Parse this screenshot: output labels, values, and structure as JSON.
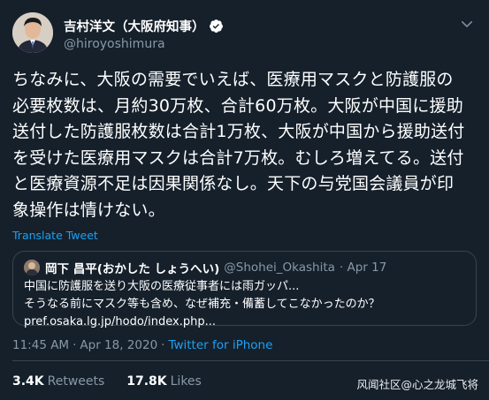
{
  "author": {
    "display_name": "吉村洋文（大阪府知事）",
    "handle": "@hiroyoshimura"
  },
  "tweet": {
    "lines": [
      "ちなみに、大阪の需要でいえば、医療用マスクと防護服の",
      "必要枚数は、月約30万枚、合計60万枚。大阪が中国に援助",
      "送付した防護服枚数は合計1万枚、大阪が中国から援助送付",
      "を受けた医療用マスクは合計7万枚。むしろ増えてる。送付",
      "と医療資源不足は因果関係なし。天下の与党国会議員が印",
      "象操作は情けない。"
    ],
    "translate_label": "Translate Tweet"
  },
  "quote": {
    "display_name": "岡下 昌平(おかした しょうへい)",
    "handle": "@Shohei_Okashita",
    "date": "· Apr 17",
    "lines": [
      "中国に防護服を送り大阪の医療従事者には雨ガッパ...",
      "そうなる前にマスク等も含め、なぜ補充・備蓄してこなかったのか？",
      "pref.osaka.lg.jp/hodo/index.php..."
    ]
  },
  "meta": {
    "time": "11:45 AM",
    "date": "Apr 18, 2020",
    "source": "Twitter for iPhone"
  },
  "stats": {
    "retweets_count": "3.4K",
    "retweets_label": "Retweets",
    "likes_count": "17.8K",
    "likes_label": "Likes"
  },
  "watermark": "风闻社区@心之龙城飞将",
  "colors": {
    "background": "#15202b",
    "secondary_text": "#8899a6",
    "link": "#1da1f2",
    "border": "#38444d"
  },
  "icons": [
    "verified-badge-icon",
    "chevron-down-icon"
  ]
}
